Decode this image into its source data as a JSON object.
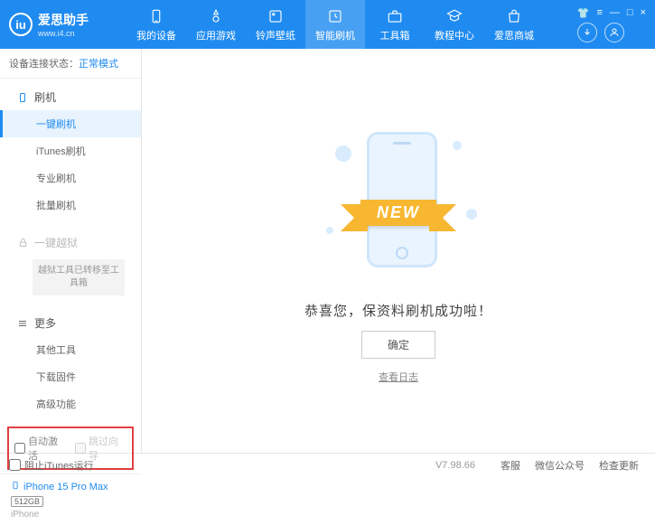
{
  "app": {
    "name_cn": "爱思助手",
    "url": "www.i4.cn"
  },
  "nav": {
    "items": [
      {
        "label": "我的设备"
      },
      {
        "label": "应用游戏"
      },
      {
        "label": "铃声壁纸"
      },
      {
        "label": "智能刷机"
      },
      {
        "label": "工具箱"
      },
      {
        "label": "教程中心"
      },
      {
        "label": "爱思商城"
      }
    ],
    "active_index": 3
  },
  "sidebar": {
    "status_label": "设备连接状态：",
    "status_mode": "正常模式",
    "flash_head": "刷机",
    "flash_items": [
      "一键刷机",
      "iTunes刷机",
      "专业刷机",
      "批量刷机"
    ],
    "flash_active": 0,
    "jailbreak_head": "一键越狱",
    "jailbreak_note": "越狱工具已转移至工具箱",
    "more_head": "更多",
    "more_items": [
      "其他工具",
      "下载固件",
      "高级功能"
    ],
    "checkbox1": "自动激活",
    "checkbox2": "跳过向导",
    "device": {
      "name": "iPhone 15 Pro Max",
      "storage": "512GB",
      "type": "iPhone"
    }
  },
  "content": {
    "ribbon": "NEW",
    "success": "恭喜您，保资料刷机成功啦！",
    "ok": "确定",
    "log_link": "查看日志"
  },
  "footer": {
    "block_itunes": "阻止iTunes运行",
    "version": "V7.98.66",
    "links": [
      "客服",
      "微信公众号",
      "检查更新"
    ]
  }
}
